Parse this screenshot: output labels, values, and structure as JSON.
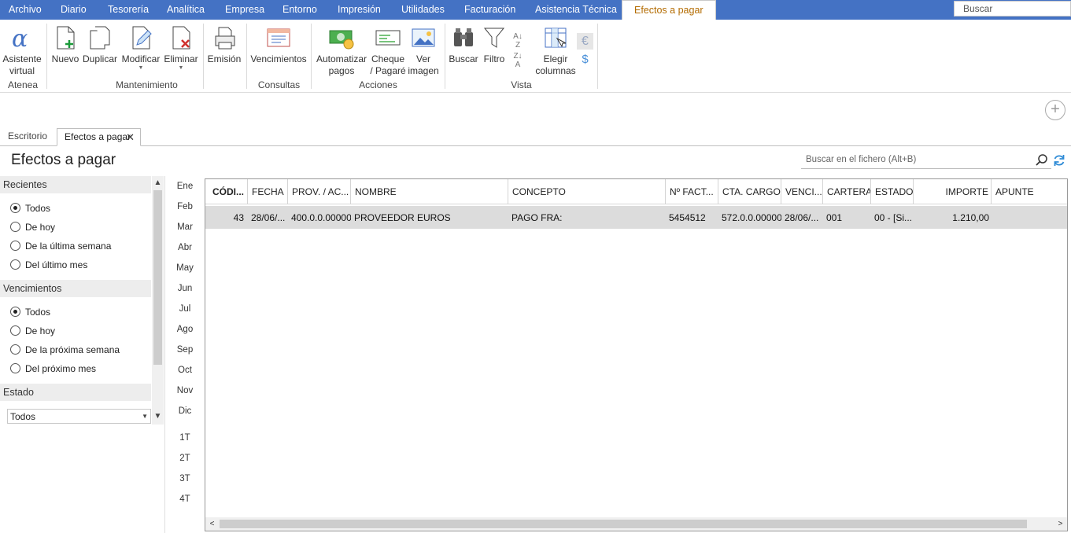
{
  "menu": {
    "tabs": [
      "Archivo",
      "Diario",
      "Tesorería",
      "Analítica",
      "Empresa",
      "Entorno",
      "Impresión",
      "Utilidades",
      "Facturación",
      "Asistencia Técnica",
      "Efectos a pagar"
    ],
    "search_placeholder": "Buscar"
  },
  "ribbon": {
    "buttons": {
      "asistente": "Asistente virtual",
      "nuevo": "Nuevo",
      "duplicar": "Duplicar",
      "modificar": "Modificar",
      "eliminar": "Eliminar",
      "emision": "Emisión",
      "vencimientos": "Vencimientos",
      "automatizar": "Automatizar pagos",
      "cheque": "Cheque / Pagaré",
      "ver_imagen": "Ver imagen",
      "buscar": "Buscar",
      "filtro": "Filtro",
      "elegir": "Elegir columnas"
    },
    "groups": {
      "atenea": "Atenea",
      "mantenimiento": "Mantenimiento",
      "consultas": "Consultas",
      "acciones": "Acciones",
      "vista": "Vista"
    }
  },
  "doc_tabs": {
    "escritorio": "Escritorio",
    "efectos": "Efectos a pagar"
  },
  "page": {
    "title": "Efectos a pagar",
    "file_search": "Buscar en el fichero (Alt+B)"
  },
  "filters": {
    "recientes": {
      "header": "Recientes",
      "options": [
        "Todos",
        "De hoy",
        "De la última semana",
        "Del último mes"
      ],
      "selected": "Todos"
    },
    "vencimientos": {
      "header": "Vencimientos",
      "options": [
        "Todos",
        "De hoy",
        "De la próxima semana",
        "Del próximo mes"
      ],
      "selected": "Todos"
    },
    "estado": {
      "header": "Estado",
      "value": "Todos"
    }
  },
  "months": [
    "Ene",
    "Feb",
    "Mar",
    "Abr",
    "May",
    "Jun",
    "Jul",
    "Ago",
    "Sep",
    "Oct",
    "Nov",
    "Dic"
  ],
  "quarters": [
    "1T",
    "2T",
    "3T",
    "4T"
  ],
  "table": {
    "columns": [
      "CÓDI...",
      "FECHA",
      "PROV. / AC...",
      "NOMBRE",
      "CONCEPTO",
      "Nº FACT...",
      "CTA. CARGO",
      "VENCI...",
      "CARTERA",
      "ESTADO",
      "IMPORTE",
      "APUNTE"
    ],
    "rows": [
      [
        "43",
        "28/06/...",
        "400.0.0.00000",
        "PROVEEDOR EUROS",
        "PAGO FRA:",
        "5454512",
        "572.0.0.00000",
        "28/06/...",
        "001",
        "00 - [Si...",
        "1.210,00",
        ""
      ]
    ]
  },
  "colors": {
    "menubar": "#4472c4",
    "active_tab_text": "#b36b00",
    "row_selected": "#dcdcdc"
  }
}
